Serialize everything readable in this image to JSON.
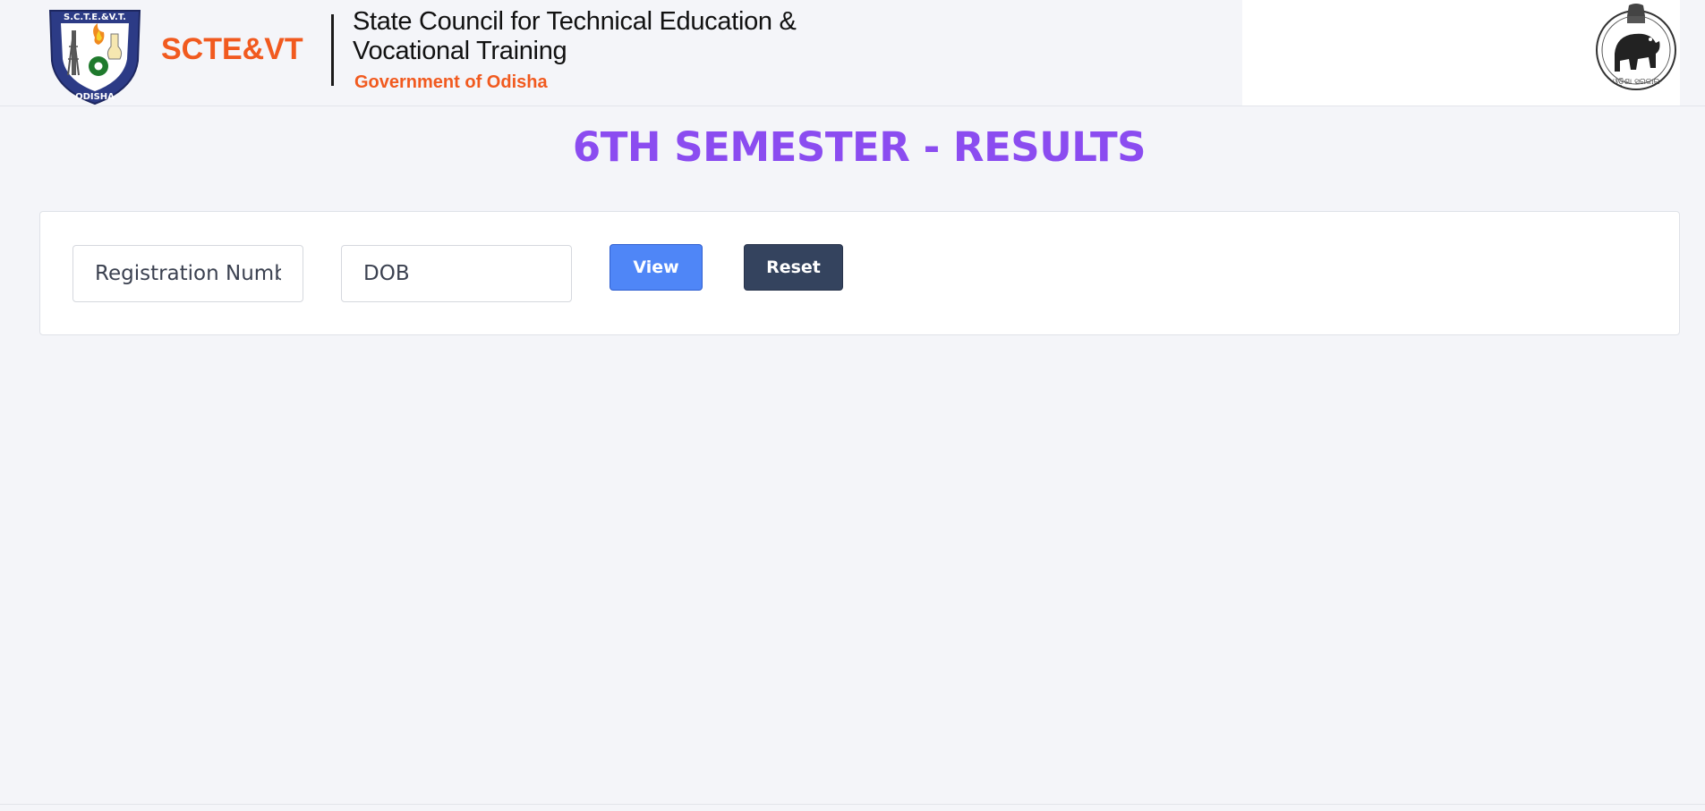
{
  "header": {
    "logo_ring_text_top": "S.C.T.E.&V.T.",
    "logo_ring_text_bottom": "ODISHA",
    "brand": "SCTE&VT",
    "org_name": "State Council for Technical Education & Vocational Training",
    "government": "Government of Odisha",
    "emblem_icon": "odisha-state-emblem-icon"
  },
  "page": {
    "title": "6TH SEMESTER - RESULTS"
  },
  "form": {
    "registration_placeholder": "Registration Number",
    "registration_value": "",
    "dob_placeholder": "DOB",
    "dob_value": "",
    "view_label": "View",
    "reset_label": "Reset"
  },
  "colors": {
    "brand_orange": "#f15a1f",
    "title_purple": "#8b4cf0",
    "view_blue": "#4f86f7",
    "reset_navy": "#34435e",
    "page_bg": "#f4f5f9"
  }
}
